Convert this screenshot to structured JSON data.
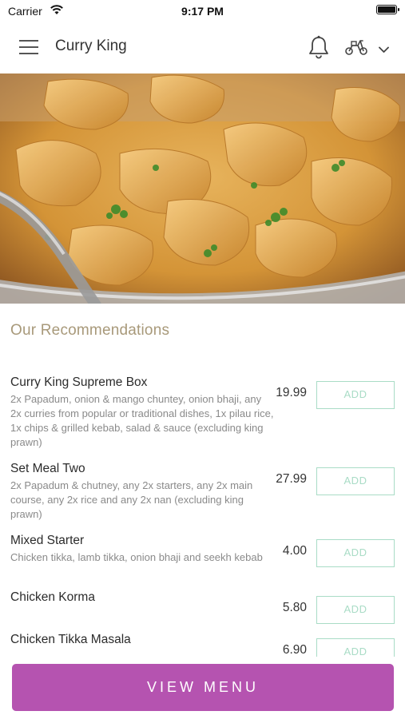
{
  "status_bar": {
    "carrier": "Carrier",
    "time": "9:17 PM"
  },
  "header": {
    "title": "Curry King",
    "menu_icon": "hamburger-menu-icon",
    "notification_icon": "bell-icon",
    "delivery_icon": "scooter-icon",
    "dropdown_icon": "chevron-down-icon"
  },
  "hero": {
    "alt": "curry dish photo"
  },
  "recommendations": {
    "title": "Our Recommendations",
    "items": [
      {
        "name": "Curry King Supreme Box",
        "description": "2x Papadum, onion & mango chuntey, onion bhaji, any 2x curries from popular or traditional dishes, 1x pilau rice, 1x chips & grilled kebab, salad & sauce (excluding king prawn)",
        "price": "19.99",
        "button": "ADD"
      },
      {
        "name": "Set Meal Two",
        "description": "2x Papadum & chutney, any 2x starters, any 2x main course, any 2x rice and any 2x nan (excluding king prawn)",
        "price": "27.99",
        "button": "ADD"
      },
      {
        "name": "Mixed Starter",
        "description": "Chicken tikka, lamb tikka, onion bhaji and seekh kebab",
        "price": "4.00",
        "button": "ADD"
      },
      {
        "name": "Chicken Korma",
        "description": "",
        "price": "5.80",
        "button": "ADD"
      },
      {
        "name": "Chicken Tikka Masala",
        "description": "",
        "price": "6.90",
        "button": "ADD"
      }
    ]
  },
  "cta": {
    "label": "VIEW MENU"
  },
  "colors": {
    "accent": "#b553b0",
    "add_border": "#a9dcc6",
    "section_title": "#a8997a"
  }
}
